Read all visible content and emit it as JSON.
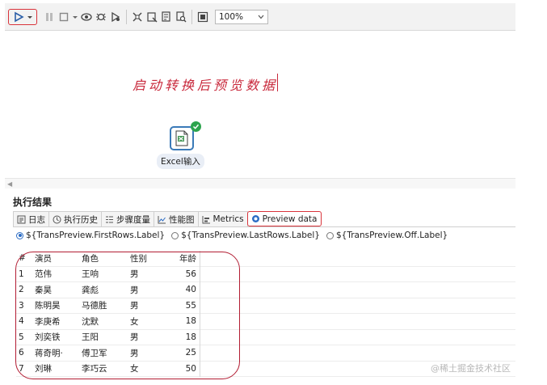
{
  "toolbar": {
    "zoom": "100%",
    "icons": [
      "run-icon",
      "dropdown-icon",
      "pause-icon",
      "stop-icon",
      "preview-icon",
      "debug-icon",
      "replay-icon",
      "verify-icon",
      "impact-icon",
      "sql-icon",
      "explore-db-icon",
      "fit-icon"
    ]
  },
  "canvas": {
    "annotation": "启动转换后预览数据",
    "step_label": "Excel输入"
  },
  "results": {
    "title": "执行结果",
    "tabs": [
      {
        "label": "日志",
        "icon": "log-icon"
      },
      {
        "label": "执行历史",
        "icon": "history-icon"
      },
      {
        "label": "步骤度量",
        "icon": "step-metrics-icon"
      },
      {
        "label": "性能图",
        "icon": "performance-chart-icon"
      },
      {
        "label": "Metrics",
        "icon": "metrics-icon"
      },
      {
        "label": "Preview data",
        "icon": "preview-eye-icon"
      }
    ],
    "active_tab": "Preview data",
    "radios": [
      {
        "label": "${TransPreview.FirstRows.Label}",
        "selected": true
      },
      {
        "label": "${TransPreview.LastRows.Label}",
        "selected": false
      },
      {
        "label": "${TransPreview.Off.Label}",
        "selected": false
      }
    ],
    "columns": [
      "#",
      "演员",
      "角色",
      "性别",
      "年龄"
    ],
    "rows": [
      [
        "1",
        "范伟",
        "王响",
        "男",
        "56"
      ],
      [
        "2",
        "秦昊",
        "龚彪",
        "男",
        "40"
      ],
      [
        "3",
        "陈明昊",
        "马德胜",
        "男",
        "55"
      ],
      [
        "4",
        "李庚希",
        "沈默",
        "女",
        "18"
      ],
      [
        "5",
        "刘奕铁",
        "王阳",
        "男",
        "18"
      ],
      [
        "6",
        "蒋奇明·",
        "傅卫军",
        "男",
        "25"
      ],
      [
        "7",
        "刘琳",
        "李巧云",
        "女",
        "50"
      ]
    ]
  },
  "watermark": "@稀土掘金技术社区",
  "colors": {
    "highlight": "#d9343b",
    "step_border": "#3a7ab8",
    "success": "#2da44e"
  }
}
